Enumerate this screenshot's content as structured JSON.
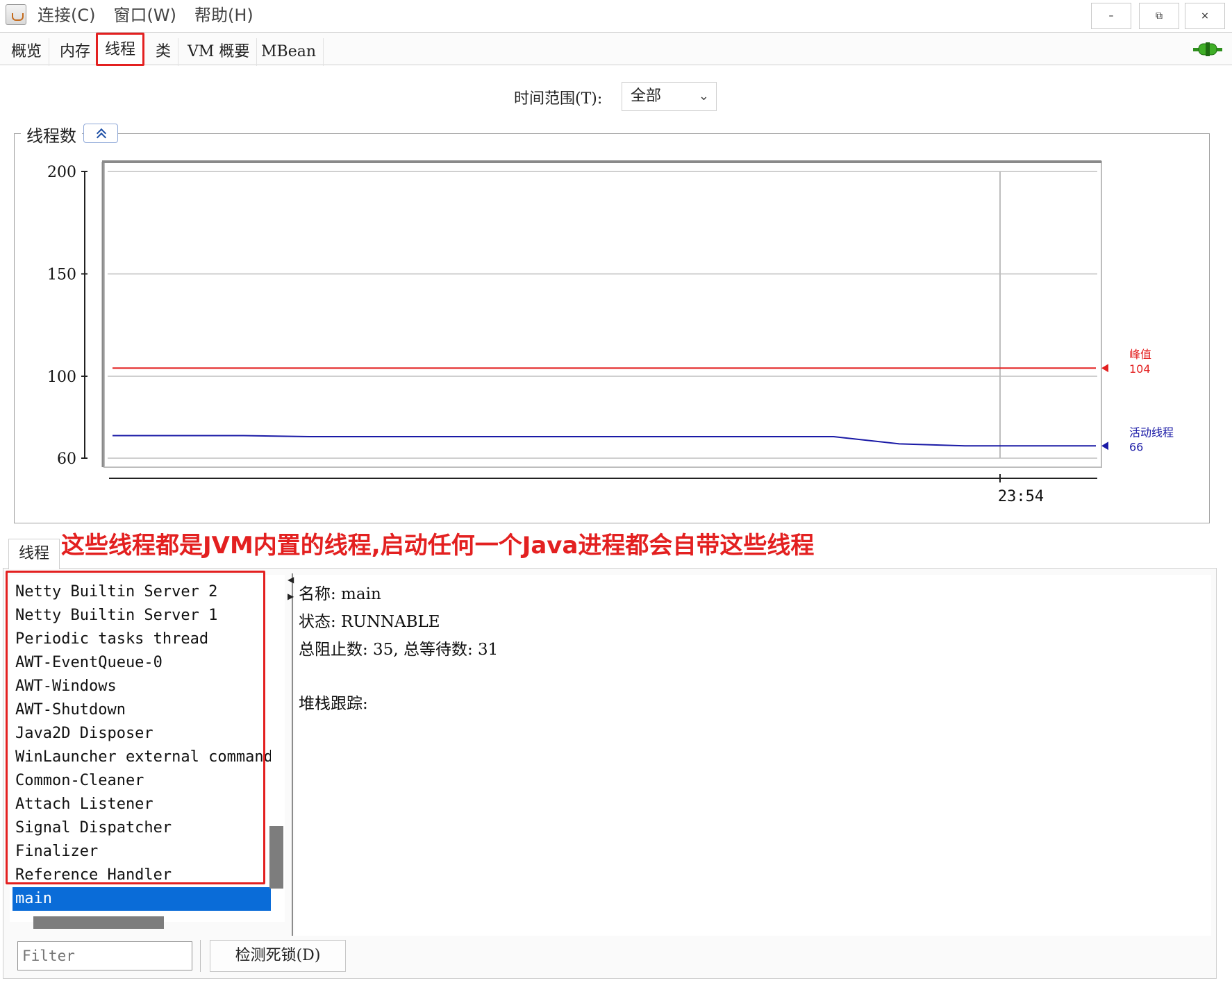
{
  "menu": [
    "连接(C)",
    "窗口(W)",
    "帮助(H)"
  ],
  "window_controls": {
    "minimize": "–",
    "restore": "⧉",
    "close": "×"
  },
  "tabs": [
    "概览",
    "内存",
    "线程",
    "类",
    "VM 概要",
    "MBean"
  ],
  "active_tab": "线程",
  "range": {
    "label": "时间范围(T):",
    "value": "全部"
  },
  "chart_title": "线程数",
  "chart_data": {
    "type": "line",
    "yticks": [
      60,
      100,
      150,
      200
    ],
    "ylim": [
      60,
      200
    ],
    "x_tick_label": "23:54",
    "series": [
      {
        "name": "峰值",
        "value_label": "104",
        "color": "#e32020",
        "values": [
          104,
          104,
          104,
          104,
          104,
          104,
          104,
          104,
          104,
          104,
          104,
          104,
          104,
          104,
          104,
          104
        ]
      },
      {
        "name": "活动线程",
        "value_label": "66",
        "color": "#1a1aa6",
        "values": [
          71,
          71,
          71,
          70.5,
          70.5,
          70.5,
          70.5,
          70.5,
          70.5,
          70.5,
          70.5,
          70.5,
          67,
          66,
          66,
          66
        ]
      }
    ]
  },
  "annotation": "这些线程都是JVM内置的线程,启动任何一个Java进程都会自带这些线程",
  "threads_tab": "线程",
  "threads": [
    "Netty Builtin Server 2",
    "Netty Builtin Server 1",
    "Periodic tasks thread",
    "AWT-EventQueue-0",
    "AWT-Windows",
    "AWT-Shutdown",
    "Java2D Disposer",
    "WinLauncher external command p",
    "Common-Cleaner",
    "Attach Listener",
    "Signal Dispatcher",
    "Finalizer",
    "Reference Handler",
    "main"
  ],
  "selected_thread": "main",
  "detail": {
    "name": "名称: main",
    "state": "状态: RUNNABLE",
    "counts": "总阻止数: 35, 总等待数: 31",
    "stack": "堆栈跟踪:"
  },
  "filter_placeholder": "Filter",
  "deadlock_button": "检测死锁(D)"
}
